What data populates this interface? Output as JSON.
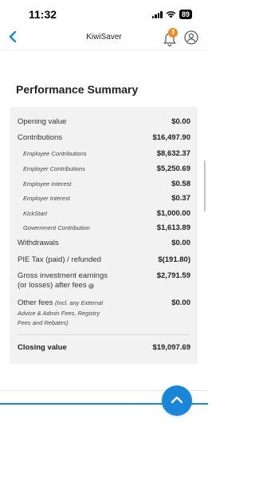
{
  "status_bar": {
    "time": "11:32",
    "battery": "89"
  },
  "nav": {
    "title": "KiwiSaver",
    "notification_count": "3"
  },
  "section_title": "Performance Summary",
  "summary": {
    "opening": {
      "label": "Opening value",
      "value": "$0.00"
    },
    "contributions": {
      "label": "Contributions",
      "value": "$16,497.90"
    },
    "contribution_items": [
      {
        "label": "Employee Contributions",
        "value": "$8,632.37"
      },
      {
        "label": "Employer Contributions",
        "value": "$5,250.69"
      },
      {
        "label": "Employee Interest",
        "value": "$0.58"
      },
      {
        "label": "Employer Interest",
        "value": "$0.37"
      },
      {
        "label": "KickStart",
        "value": "$1,000.00"
      },
      {
        "label": "Government Contribution",
        "value": "$1,613.89"
      }
    ],
    "withdrawals": {
      "label": "Withdrawals",
      "value": "$0.00"
    },
    "pie_tax": {
      "label": "PIE Tax (paid) / refunded",
      "value": "$(191.80)"
    },
    "gross_earnings": {
      "label_line1": "Gross investment earnings",
      "label_line2": "(or losses) after fees",
      "value": "$2,791.59"
    },
    "other_fees": {
      "label": "Other fees",
      "note_line1": "(Incl. any External",
      "note_line2": "Advice & Admin Fees, Registry",
      "note_line3": "Fees and Rebates)",
      "value": "$0.00"
    },
    "closing": {
      "label": "Closing value",
      "value": "$19,097.69"
    }
  },
  "colors": {
    "accent": "#1a86d8",
    "badge": "#f08a24",
    "card": "#f2f2f2"
  }
}
